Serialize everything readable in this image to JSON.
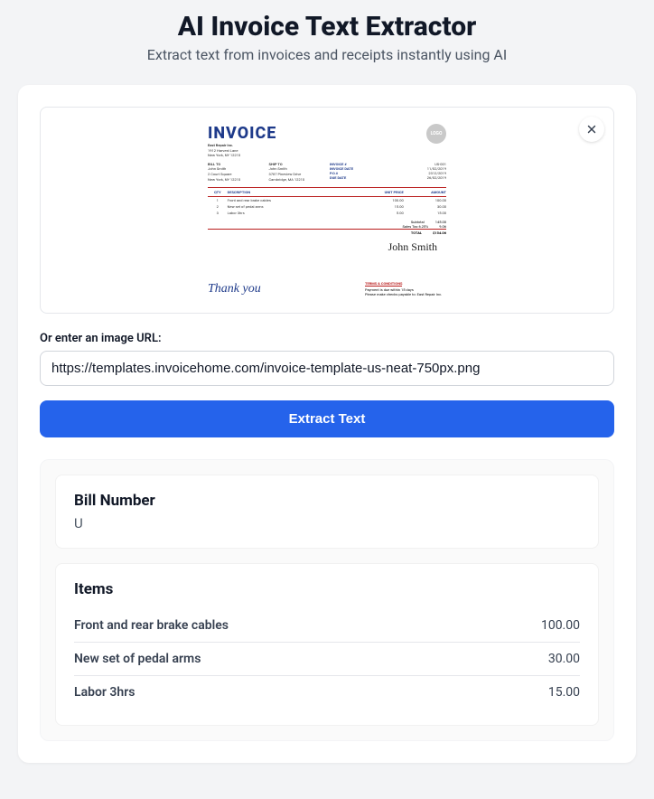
{
  "header": {
    "title": "AI Invoice Text Extractor",
    "subtitle": "Extract text from invoices and receipts instantly using AI"
  },
  "preview": {
    "close_label": "Close"
  },
  "invoice_preview": {
    "title": "INVOICE",
    "logo": "LOGO",
    "company": "East Repair Inc.",
    "addr1": "1912 Harvest Lane",
    "addr2": "New York, NY 12210",
    "bill_to_h": "BILL TO",
    "bill_to_1": "John Smith",
    "bill_to_2": "2 Court Square",
    "bill_to_3": "New York, NY 12210",
    "ship_to_h": "SHIP TO",
    "ship_to_1": "John Smith",
    "ship_to_2": "3787 Pineview Drive",
    "ship_to_3": "Cambridge, MA 12210",
    "meta": {
      "inv_no_l": "INVOICE #",
      "inv_no_v": "US-001",
      "inv_date_l": "INVOICE DATE",
      "inv_date_v": "11/02/2019",
      "po_l": "P.O.#",
      "po_v": "2312/2019",
      "due_l": "DUE DATE",
      "due_v": "26/02/2019"
    },
    "th": {
      "qty": "QTY",
      "desc": "DESCRIPTION",
      "price": "UNIT PRICE",
      "amount": "AMOUNT"
    },
    "rows": [
      {
        "q": "1",
        "d": "Front and rear brake cables",
        "p": "100.00",
        "a": "100.00"
      },
      {
        "q": "2",
        "d": "New set of pedal arms",
        "p": "15.00",
        "a": "30.00"
      },
      {
        "q": "3",
        "d": "Labor 3hrs",
        "p": "5.00",
        "a": "15.00"
      }
    ],
    "totals": {
      "subtotal_l": "Subtotal",
      "subtotal_v": "145.00",
      "tax_l": "Sales Tax 6.25%",
      "tax_v": "9.06",
      "total_l": "TOTAL",
      "total_v": "$154.06"
    },
    "signature": "John Smith",
    "thank": "Thank you",
    "terms_h": "TERMS & CONDITIONS",
    "terms_1": "Payment is due within 15 days",
    "terms_2": "Please make checks payable to: East Repair Inc."
  },
  "url_section": {
    "label": "Or enter an image URL:",
    "value": "https://templates.invoicehome.com/invoice-template-us-neat-750px.png"
  },
  "extract_button": "Extract Text",
  "results": {
    "bill_number": {
      "label": "Bill Number",
      "value": "U"
    },
    "items": {
      "label": "Items",
      "list": [
        {
          "name": "Front and rear brake cables",
          "price": "100.00"
        },
        {
          "name": "New set of pedal arms",
          "price": "30.00"
        },
        {
          "name": "Labor 3hrs",
          "price": "15.00"
        }
      ]
    }
  }
}
